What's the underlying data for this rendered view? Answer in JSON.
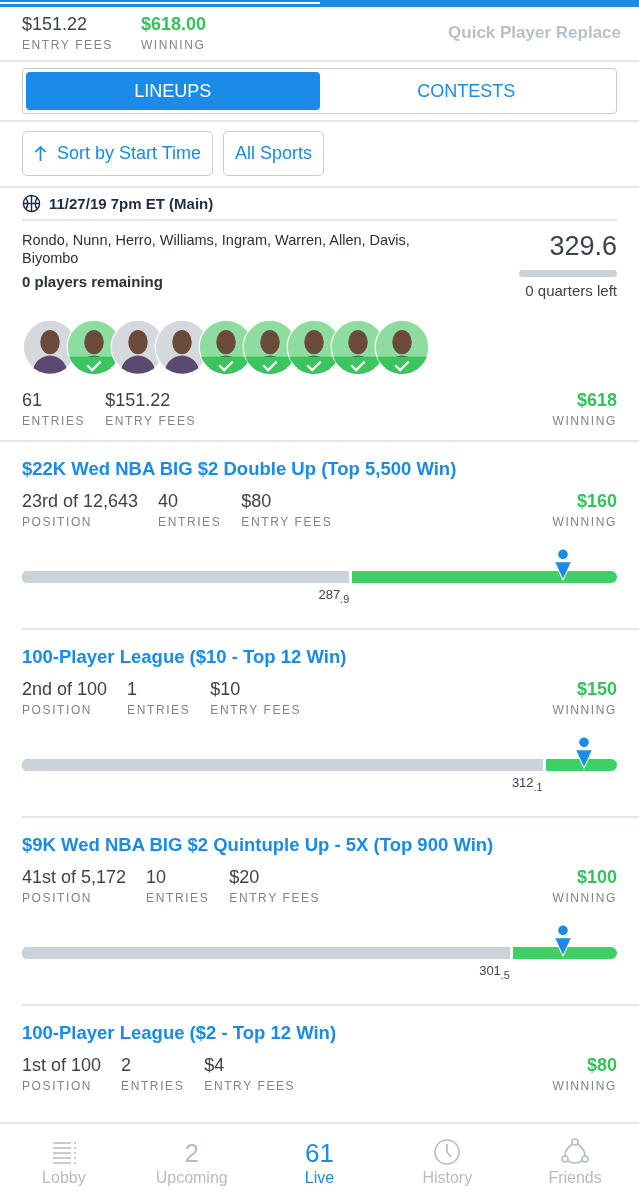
{
  "header": {
    "entry_fees": {
      "value": "$151.22",
      "label": "ENTRY FEES"
    },
    "winning": {
      "value": "$618.00",
      "label": "WINNING"
    },
    "action": "Quick Player Replace"
  },
  "tabs": [
    {
      "label": "LINEUPS",
      "selected": true
    },
    {
      "label": "CONTESTS",
      "selected": false
    }
  ],
  "filters": [
    {
      "label": "Sort by Start Time",
      "kind": "sort"
    },
    {
      "label": "All Sports",
      "kind": "plain"
    }
  ],
  "slate": "11/27/19 7pm ET (Main)",
  "lineup": {
    "players": "Rondo, Nunn, Herro, Williams, Ingram, Warren, Allen, Davis, Biyombo",
    "remaining": "0 players remaining",
    "score": "329.6",
    "time_left": "0 quarters left",
    "avatars": [
      {
        "checked": false
      },
      {
        "checked": true
      },
      {
        "checked": false
      },
      {
        "checked": false
      },
      {
        "checked": true
      },
      {
        "checked": true
      },
      {
        "checked": true
      },
      {
        "checked": true
      },
      {
        "checked": true
      }
    ],
    "stats": [
      {
        "value": "61",
        "label": "ENTRIES"
      },
      {
        "value": "$151.22",
        "label": "ENTRY FEES"
      }
    ],
    "winning": {
      "value": "$618",
      "label": "WINNING"
    }
  },
  "contests": [
    {
      "title": "$22K Wed NBA BIG $2 Double Up (Top 5,500 Win)",
      "stats": [
        {
          "value": "23rd of 12,643",
          "label": "POSITION"
        },
        {
          "value": "40",
          "label": "ENTRIES"
        },
        {
          "value": "$80",
          "label": "ENTRY FEES"
        }
      ],
      "winning": {
        "value": "$160",
        "label": "WINNING"
      },
      "cash_line": {
        "level": 0.55,
        "reading": "287$_{.9}$"
      },
      "marker": {
        "level": 0.91
      }
    },
    {
      "title": "100-Player League ($10 - Top 12 Win)",
      "stats": [
        {
          "value": "2nd of 100",
          "label": "POSITION"
        },
        {
          "value": "1",
          "label": "ENTRIES"
        },
        {
          "value": "$10",
          "label": "ENTRY FEES"
        }
      ],
      "winning": {
        "value": "$150",
        "label": "WINNING"
      },
      "cash_line": {
        "level": 0.875,
        "reading": "312$_{.1}$"
      },
      "marker": {
        "level": 0.945
      }
    },
    {
      "title": "$9K Wed NBA BIG $2 Quintuple Up - 5X (Top 900 Win)",
      "stats": [
        {
          "value": "41st of 5,172",
          "label": "POSITION"
        },
        {
          "value": "10",
          "label": "ENTRIES"
        },
        {
          "value": "$20",
          "label": "ENTRY FEES"
        }
      ],
      "winning": {
        "value": "$100",
        "label": "WINNING"
      },
      "cash_line": {
        "level": 0.82,
        "reading": "301$_{.5}$"
      },
      "marker": {
        "level": 0.91
      }
    },
    {
      "title": "100-Player League ($2 - Top 12 Win)",
      "stats": [
        {
          "value": "1st of 100",
          "label": "POSITION"
        },
        {
          "value": "2",
          "label": "ENTRIES"
        },
        {
          "value": "$4",
          "label": "ENTRY FEES"
        }
      ],
      "winning": {
        "value": "$80",
        "label": "WINNING"
      }
    }
  ],
  "nav": [
    {
      "label": "Lobby",
      "kind": "list",
      "selected": false
    },
    {
      "label": "Upcoming",
      "kind": "count",
      "count": "2",
      "selected": false
    },
    {
      "label": "Live",
      "kind": "count",
      "count": "61",
      "selected": true
    },
    {
      "label": "History",
      "kind": "clock",
      "selected": false
    },
    {
      "label": "Friends",
      "kind": "friends",
      "selected": false
    }
  ]
}
